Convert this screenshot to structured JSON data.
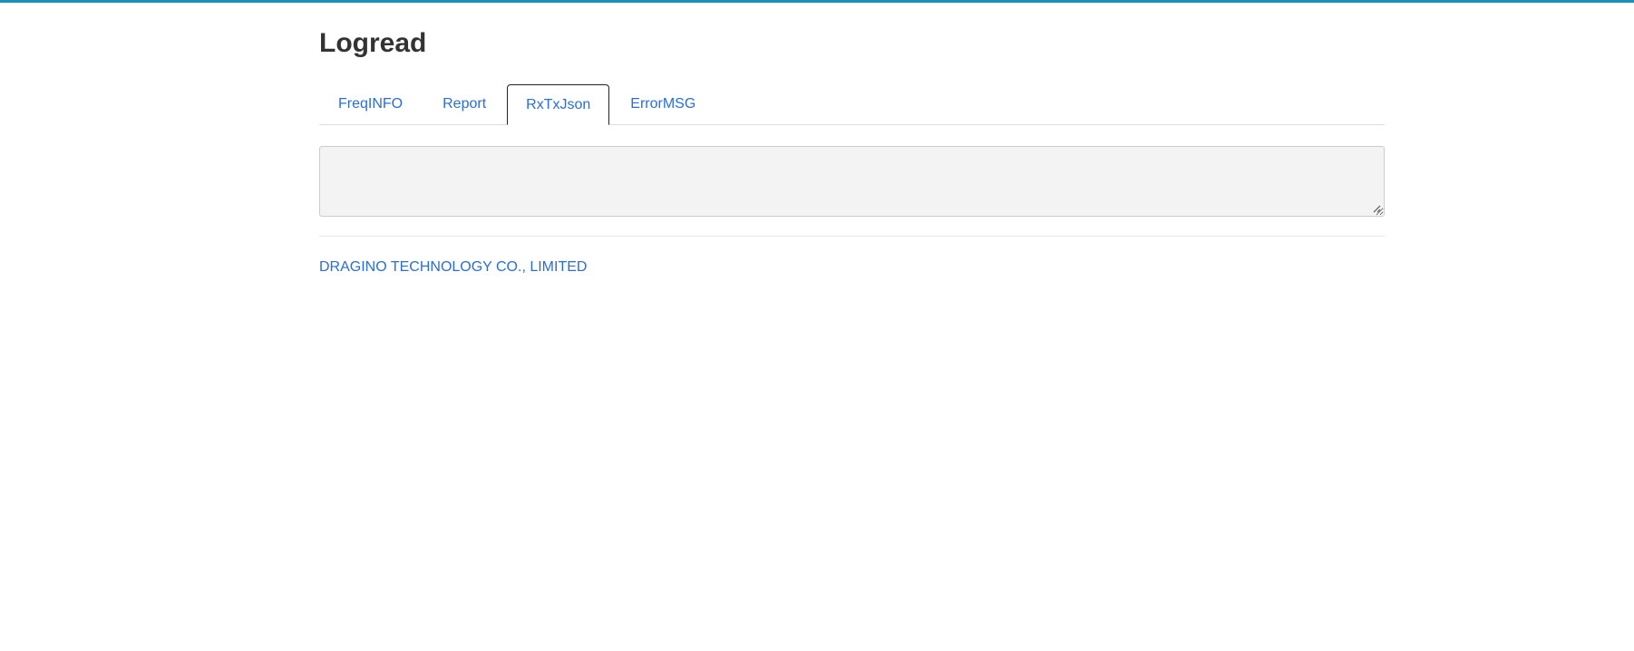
{
  "page": {
    "title": "Logread"
  },
  "tabs": [
    {
      "label": "FreqINFO",
      "active": false
    },
    {
      "label": "Report",
      "active": false
    },
    {
      "label": "RxTxJson",
      "active": true
    },
    {
      "label": "ErrorMSG",
      "active": false
    }
  ],
  "log": {
    "value": ""
  },
  "footer": {
    "company": "DRAGINO TECHNOLOGY CO., LIMITED"
  },
  "colors": {
    "accent_bar": "#1a8fb8",
    "link": "#2a6ed2"
  }
}
